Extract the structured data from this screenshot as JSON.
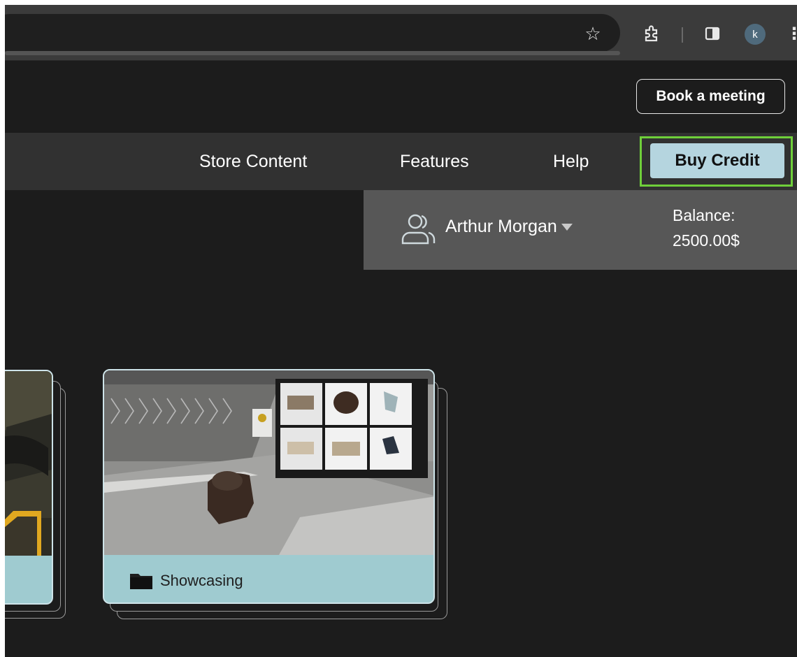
{
  "browser": {
    "toolbar_icons": [
      "star-icon",
      "extensions-icon",
      "side-panel-icon",
      "menu-icon"
    ],
    "profile_initial": "k"
  },
  "header": {
    "book_meeting": "Book a meeting"
  },
  "nav": {
    "items": [
      {
        "label": "Store Content"
      },
      {
        "label": "Features"
      },
      {
        "label": "Help"
      }
    ],
    "buy_credit": "Buy Credit"
  },
  "account": {
    "user_name": "Arthur Morgan",
    "balance_label": "Balance:",
    "balance_value": "2500.00$"
  },
  "cards": [
    {
      "category": "Showcasing"
    }
  ],
  "colors": {
    "accent_teal": "#9fcbd0",
    "button_blue": "#b5d5df",
    "highlight_green": "#6fcf3a",
    "background": "#1c1c1c"
  }
}
